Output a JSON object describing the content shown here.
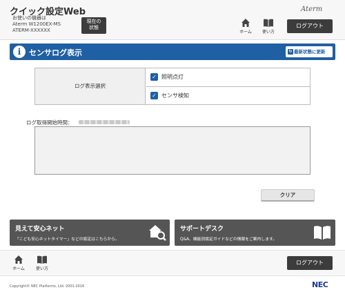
{
  "header": {
    "app_title": "クイック設定Web",
    "device_line1": "お使いの機器は",
    "device_line2": "Aterm W1200EX-MS",
    "device_line3": "ATERM-XXXXXX",
    "status_button_line1": "現在の",
    "status_button_line2": "状態",
    "brand": "Aterm",
    "home_label": "ホーム",
    "usage_label": "使い方",
    "logout_label": "ログアウト"
  },
  "titlebar": {
    "icon": "i",
    "title": "センサログ表示",
    "refresh_label": "最新状態に更新"
  },
  "log_select": {
    "label": "ログ表示選択",
    "options": [
      {
        "label": "照明点灯",
        "checked": true
      },
      {
        "label": "センサ検知",
        "checked": true
      }
    ]
  },
  "log": {
    "start_time_label": "ログ取得開始時間：",
    "clear_label": "クリア"
  },
  "banners": [
    {
      "title": "見えて安心ネット",
      "desc": "「こども安心ネットタイマー」などの設定はこちらから。",
      "icon": "house-search-icon"
    },
    {
      "title": "サポートデスク",
      "desc": "Q&A、機能別設定ガイドなどの情報をご案内します。",
      "icon": "book-icon"
    }
  ],
  "footer": {
    "home_label": "ホーム",
    "usage_label": "使い方",
    "logout_label": "ログアウト",
    "copyright": "Copyright© NEC Platforms, Ltd. 2001-2016",
    "nec_logo": "NEC"
  },
  "colors": {
    "accent_blue": "#1f5fa3",
    "dark_button": "#3c3c3c",
    "banner_gray": "#555555"
  }
}
